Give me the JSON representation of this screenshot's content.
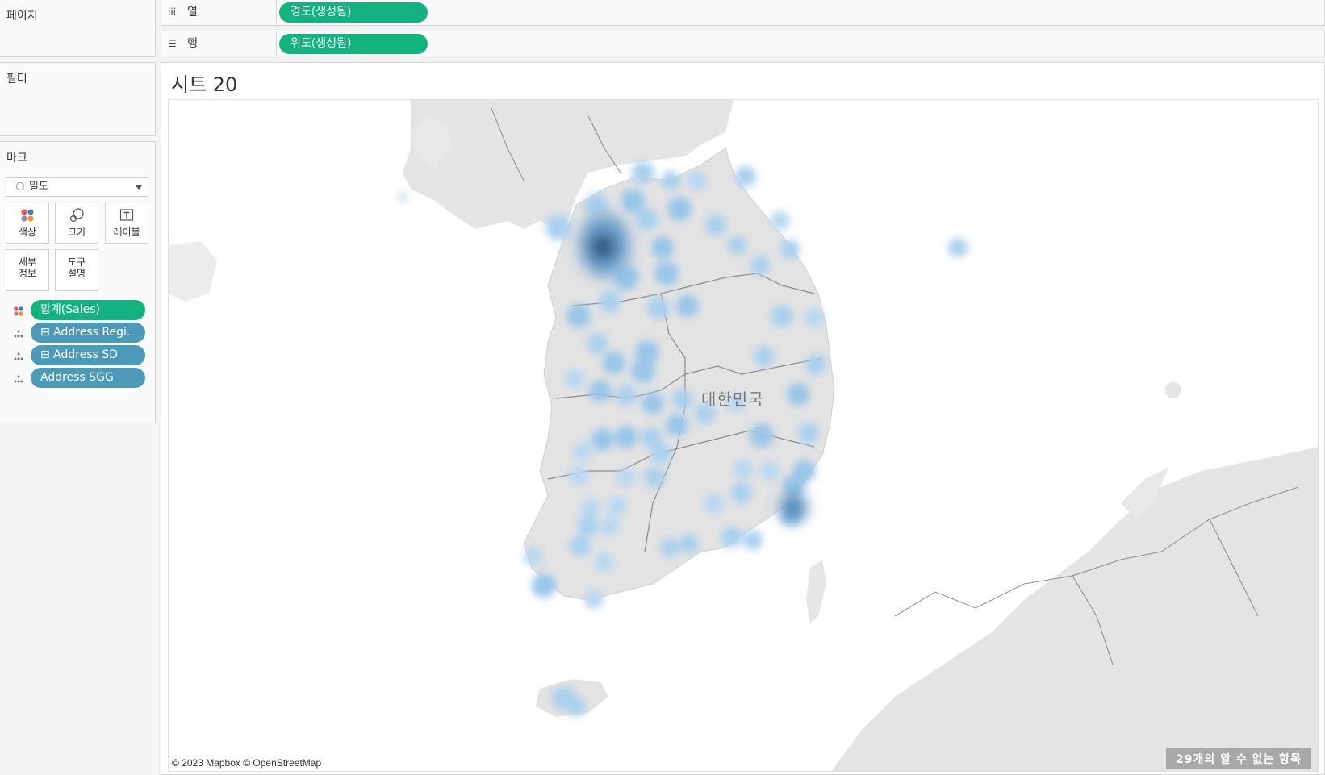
{
  "left": {
    "pages_title": "페이지",
    "filters_title": "필터",
    "marks_title": "마크",
    "mark_type": "밀도",
    "buttons": {
      "color": "색상",
      "size": "크기",
      "label": "레이블",
      "detail_1": "세부",
      "detail_2": "정보",
      "tooltip_1": "도구",
      "tooltip_2": "설명"
    },
    "pills": [
      {
        "label": "합계(Sales)",
        "icon": "color-dots-icon"
      },
      {
        "label": "⊟ Address Regi..",
        "icon": "detail-icon"
      },
      {
        "label": "⊟ Address SD",
        "icon": "detail-icon"
      },
      {
        "label": "Address SGG",
        "icon": "detail-icon"
      }
    ]
  },
  "shelves": {
    "columns_label": "열",
    "columns_pill": "경도(생성됨)",
    "rows_label": "행",
    "rows_pill": "위도(생성됨)"
  },
  "view": {
    "sheet_title": "시트 20",
    "country_label": "대한민국",
    "attribution": "© 2023 Mapbox © OpenStreetMap",
    "unknown_items": "29개의 알 수 없는 항목"
  },
  "colors": {
    "pill_green": "#13b27f",
    "pill_blue": "#4d9ab8",
    "density_light": "#a9d0ee",
    "density_dark": "#1f4f7a"
  }
}
